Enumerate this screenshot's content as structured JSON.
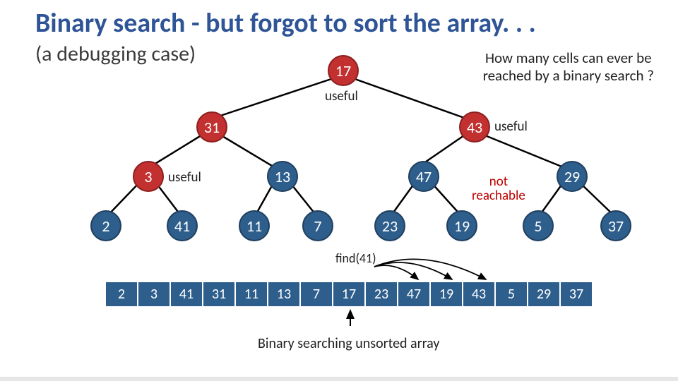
{
  "title": "Binary search  - but forgot to sort the array. . .",
  "subtitle": "(a debugging case)",
  "question_line1": "How many cells can ever be",
  "question_line2": "reached by a binary search ?",
  "labels": {
    "useful": "useful",
    "not_reachable": "not\nreachable",
    "find": "find(41)",
    "caption": "Binary searching unsorted array"
  },
  "tree": {
    "root": "17",
    "l": {
      "v": "31",
      "l": {
        "v": "3",
        "l": {
          "v": "2"
        },
        "r": {
          "v": "41"
        }
      },
      "r": {
        "v": "13",
        "l": {
          "v": "11"
        },
        "r": {
          "v": "7"
        }
      }
    },
    "r": {
      "v": "43",
      "l": {
        "v": "47",
        "l": {
          "v": "23"
        },
        "r": {
          "v": "19"
        }
      },
      "r": {
        "v": "29",
        "l": {
          "v": "5"
        },
        "r": {
          "v": "37"
        }
      }
    }
  },
  "array": [
    "2",
    "3",
    "41",
    "31",
    "11",
    "13",
    "7",
    "17",
    "23",
    "47",
    "19",
    "43",
    "5",
    "29",
    "37"
  ],
  "chart_data": {
    "type": "table",
    "title": "Binary search tree over unsorted array (midpoint tree)",
    "array": [
      2,
      3,
      41,
      31,
      11,
      13,
      7,
      17,
      23,
      47,
      19,
      43,
      5,
      29,
      37
    ],
    "tree_levels": [
      [
        17
      ],
      [
        31,
        43
      ],
      [
        3,
        13,
        47,
        29
      ],
      [
        2,
        41,
        11,
        7,
        23,
        19,
        5,
        37
      ]
    ],
    "useful_nodes": [
      17,
      31,
      3,
      43
    ],
    "not_reachable_annotation_between": [
      47,
      29
    ],
    "target": 41
  }
}
